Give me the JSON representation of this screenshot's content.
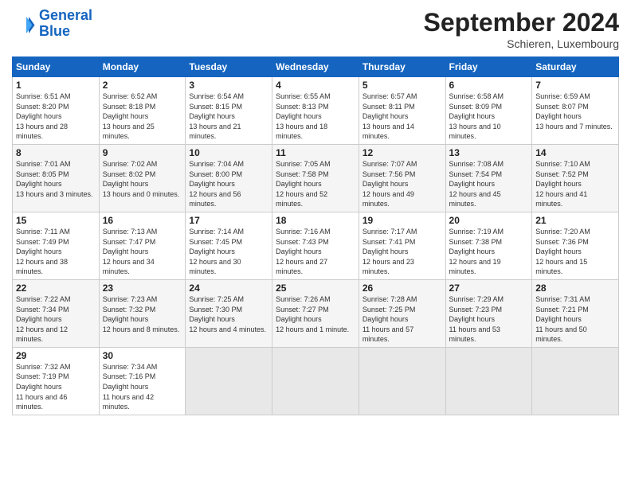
{
  "header": {
    "logo_line1": "General",
    "logo_line2": "Blue",
    "month": "September 2024",
    "location": "Schieren, Luxembourg"
  },
  "columns": [
    "Sunday",
    "Monday",
    "Tuesday",
    "Wednesday",
    "Thursday",
    "Friday",
    "Saturday"
  ],
  "weeks": [
    [
      {
        "num": "1",
        "sunrise": "6:51 AM",
        "sunset": "8:20 PM",
        "daylight": "13 hours and 28 minutes."
      },
      {
        "num": "2",
        "sunrise": "6:52 AM",
        "sunset": "8:18 PM",
        "daylight": "13 hours and 25 minutes."
      },
      {
        "num": "3",
        "sunrise": "6:54 AM",
        "sunset": "8:15 PM",
        "daylight": "13 hours and 21 minutes."
      },
      {
        "num": "4",
        "sunrise": "6:55 AM",
        "sunset": "8:13 PM",
        "daylight": "13 hours and 18 minutes."
      },
      {
        "num": "5",
        "sunrise": "6:57 AM",
        "sunset": "8:11 PM",
        "daylight": "13 hours and 14 minutes."
      },
      {
        "num": "6",
        "sunrise": "6:58 AM",
        "sunset": "8:09 PM",
        "daylight": "13 hours and 10 minutes."
      },
      {
        "num": "7",
        "sunrise": "6:59 AM",
        "sunset": "8:07 PM",
        "daylight": "13 hours and 7 minutes."
      }
    ],
    [
      {
        "num": "8",
        "sunrise": "7:01 AM",
        "sunset": "8:05 PM",
        "daylight": "13 hours and 3 minutes."
      },
      {
        "num": "9",
        "sunrise": "7:02 AM",
        "sunset": "8:02 PM",
        "daylight": "13 hours and 0 minutes."
      },
      {
        "num": "10",
        "sunrise": "7:04 AM",
        "sunset": "8:00 PM",
        "daylight": "12 hours and 56 minutes."
      },
      {
        "num": "11",
        "sunrise": "7:05 AM",
        "sunset": "7:58 PM",
        "daylight": "12 hours and 52 minutes."
      },
      {
        "num": "12",
        "sunrise": "7:07 AM",
        "sunset": "7:56 PM",
        "daylight": "12 hours and 49 minutes."
      },
      {
        "num": "13",
        "sunrise": "7:08 AM",
        "sunset": "7:54 PM",
        "daylight": "12 hours and 45 minutes."
      },
      {
        "num": "14",
        "sunrise": "7:10 AM",
        "sunset": "7:52 PM",
        "daylight": "12 hours and 41 minutes."
      }
    ],
    [
      {
        "num": "15",
        "sunrise": "7:11 AM",
        "sunset": "7:49 PM",
        "daylight": "12 hours and 38 minutes."
      },
      {
        "num": "16",
        "sunrise": "7:13 AM",
        "sunset": "7:47 PM",
        "daylight": "12 hours and 34 minutes."
      },
      {
        "num": "17",
        "sunrise": "7:14 AM",
        "sunset": "7:45 PM",
        "daylight": "12 hours and 30 minutes."
      },
      {
        "num": "18",
        "sunrise": "7:16 AM",
        "sunset": "7:43 PM",
        "daylight": "12 hours and 27 minutes."
      },
      {
        "num": "19",
        "sunrise": "7:17 AM",
        "sunset": "7:41 PM",
        "daylight": "12 hours and 23 minutes."
      },
      {
        "num": "20",
        "sunrise": "7:19 AM",
        "sunset": "7:38 PM",
        "daylight": "12 hours and 19 minutes."
      },
      {
        "num": "21",
        "sunrise": "7:20 AM",
        "sunset": "7:36 PM",
        "daylight": "12 hours and 15 minutes."
      }
    ],
    [
      {
        "num": "22",
        "sunrise": "7:22 AM",
        "sunset": "7:34 PM",
        "daylight": "12 hours and 12 minutes."
      },
      {
        "num": "23",
        "sunrise": "7:23 AM",
        "sunset": "7:32 PM",
        "daylight": "12 hours and 8 minutes."
      },
      {
        "num": "24",
        "sunrise": "7:25 AM",
        "sunset": "7:30 PM",
        "daylight": "12 hours and 4 minutes."
      },
      {
        "num": "25",
        "sunrise": "7:26 AM",
        "sunset": "7:27 PM",
        "daylight": "12 hours and 1 minute."
      },
      {
        "num": "26",
        "sunrise": "7:28 AM",
        "sunset": "7:25 PM",
        "daylight": "11 hours and 57 minutes."
      },
      {
        "num": "27",
        "sunrise": "7:29 AM",
        "sunset": "7:23 PM",
        "daylight": "11 hours and 53 minutes."
      },
      {
        "num": "28",
        "sunrise": "7:31 AM",
        "sunset": "7:21 PM",
        "daylight": "11 hours and 50 minutes."
      }
    ],
    [
      {
        "num": "29",
        "sunrise": "7:32 AM",
        "sunset": "7:19 PM",
        "daylight": "11 hours and 46 minutes."
      },
      {
        "num": "30",
        "sunrise": "7:34 AM",
        "sunset": "7:16 PM",
        "daylight": "11 hours and 42 minutes."
      },
      null,
      null,
      null,
      null,
      null
    ]
  ]
}
